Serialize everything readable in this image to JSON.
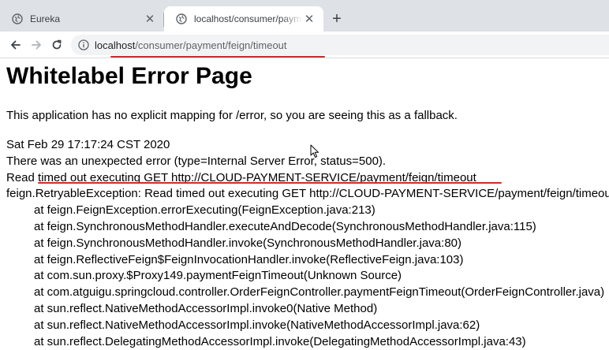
{
  "browser": {
    "tabs": [
      {
        "title": "Eureka",
        "icon": "globe-icon",
        "active": false
      },
      {
        "title": "localhost/consumer/payment/feign/timeout",
        "icon": "globe-icon",
        "active": true
      }
    ],
    "address": {
      "host": "localhost",
      "path": "/consumer/payment/feign/timeout"
    },
    "annotation_color": "#e02424"
  },
  "page": {
    "heading": "Whitelabel Error Page",
    "message": "This application has no explicit mapping for /error, so you are seeing this as a fallback.",
    "timestamp": "Sat Feb 29 17:17:24 CST 2020",
    "error_line": "There was an unexpected error (type=Internal Server Error, status=500).",
    "read_line": "Read timed out executing GET http://CLOUD-PAYMENT-SERVICE/payment/feign/timeout",
    "exception_line": "feign.RetryableException: Read timed out executing GET http://CLOUD-PAYMENT-SERVICE/payment/feign/timeout",
    "stack": [
      "at feign.FeignException.errorExecuting(FeignException.java:213)",
      "at feign.SynchronousMethodHandler.executeAndDecode(SynchronousMethodHandler.java:115)",
      "at feign.SynchronousMethodHandler.invoke(SynchronousMethodHandler.java:80)",
      "at feign.ReflectiveFeign$FeignInvocationHandler.invoke(ReflectiveFeign.java:103)",
      "at com.sun.proxy.$Proxy149.paymentFeignTimeout(Unknown Source)",
      "at com.atguigu.springcloud.controller.OrderFeignController.paymentFeignTimeout(OrderFeignController.java)",
      "at sun.reflect.NativeMethodAccessorImpl.invoke0(Native Method)",
      "at sun.reflect.NativeMethodAccessorImpl.invoke(NativeMethodAccessorImpl.java:62)",
      "at sun.reflect.DelegatingMethodAccessorImpl.invoke(DelegatingMethodAccessorImpl.java:43)"
    ]
  }
}
